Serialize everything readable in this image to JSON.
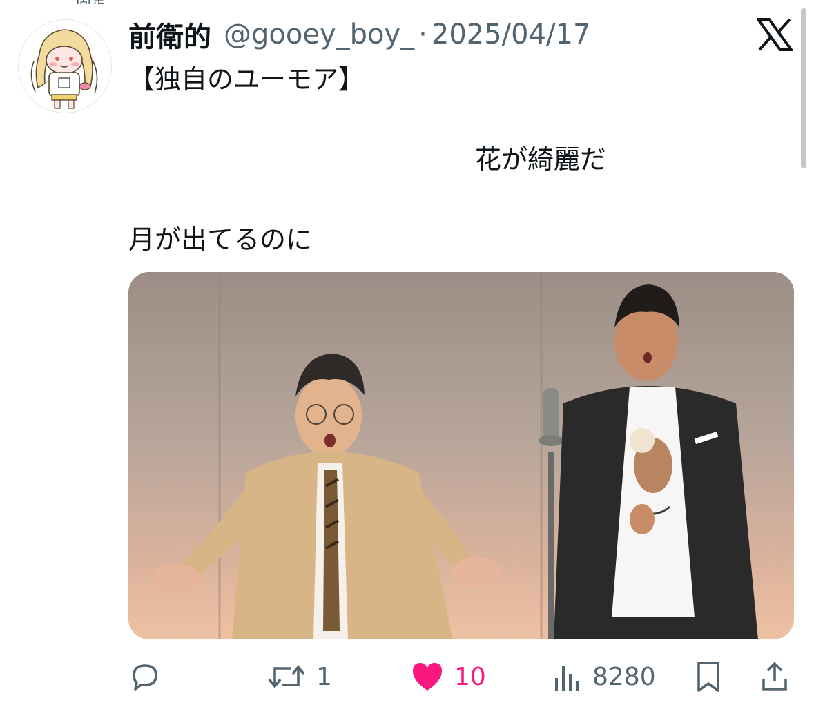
{
  "tweet": {
    "header_fragment": "固定",
    "author": {
      "display_name": "前衛的",
      "handle": "@gooey_boy_",
      "avatar_icon": "avatar-illustration-icon"
    },
    "separator": "·",
    "date": "2025/04/17",
    "source_icon": "x-logo-icon",
    "text_lines": [
      "【独自のユーモア】",
      "花が綺麗だ",
      "月が出てるのに"
    ],
    "media": {
      "kind": "photo",
      "description_icon": "stage-photo-icon"
    },
    "stats": {
      "replies": "",
      "retweets": "1",
      "likes": "10",
      "views": "8280"
    },
    "like_color": "#f91880",
    "icon_color": "#536471"
  }
}
